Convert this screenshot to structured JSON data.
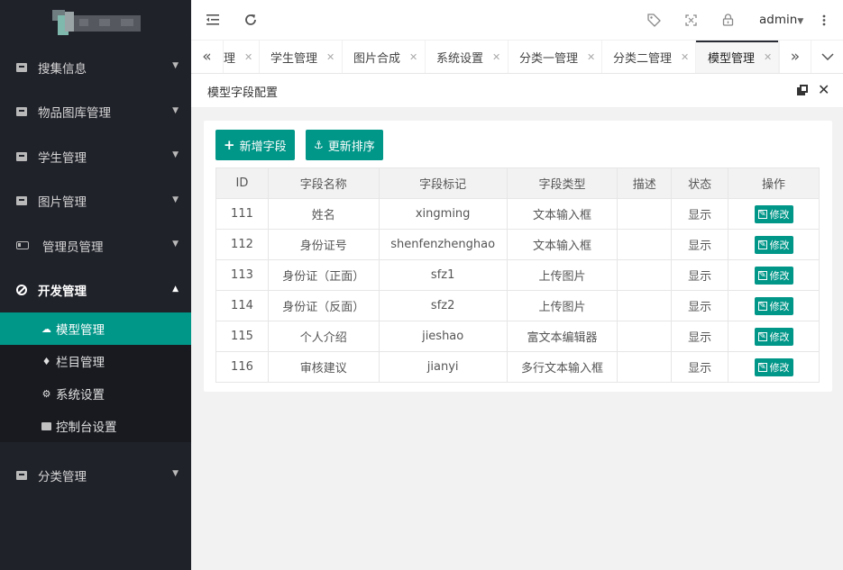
{
  "sidebar": {
    "menu": [
      {
        "label": "搜集信息",
        "icon": "archive-icon"
      },
      {
        "label": "物品图库管理",
        "icon": "archive-icon"
      },
      {
        "label": "学生管理",
        "icon": "archive-icon"
      },
      {
        "label": "图片管理",
        "icon": "archive-icon"
      },
      {
        "label": "管理员管理",
        "icon": "battery-icon"
      },
      {
        "label": "开发管理",
        "icon": "ban-icon"
      },
      {
        "label": "分类管理",
        "icon": "archive-icon"
      }
    ],
    "submenu": [
      {
        "label": "模型管理",
        "icon": "cloud-icon"
      },
      {
        "label": "栏目管理",
        "icon": "bell-icon"
      },
      {
        "label": "系统设置",
        "icon": "gear-icon"
      },
      {
        "label": "控制台设置",
        "icon": "archive-icon"
      }
    ]
  },
  "header": {
    "user": "admin",
    "icons": [
      "collapse-menu-icon",
      "refresh-icon",
      "tag-icon",
      "fullscreen-icon",
      "lock-icon",
      "more-icon"
    ]
  },
  "tabs": {
    "items": [
      {
        "label": "理"
      },
      {
        "label": "学生管理"
      },
      {
        "label": "图片合成"
      },
      {
        "label": "系统设置"
      },
      {
        "label": "分类一管理"
      },
      {
        "label": "分类二管理"
      },
      {
        "label": "模型管理",
        "active": true
      }
    ]
  },
  "page": {
    "title": "模型字段配置",
    "add_button": "新增字段",
    "sort_button": "更新排序",
    "edit_label": "修改",
    "columns": [
      "ID",
      "字段名称",
      "字段标记",
      "字段类型",
      "描述",
      "状态",
      "操作"
    ],
    "rows": [
      {
        "id": "111",
        "name": "姓名",
        "mark": "xingming",
        "type": "文本输入框",
        "desc": "",
        "status": "显示"
      },
      {
        "id": "112",
        "name": "身份证号",
        "mark": "shenfenzhenghao",
        "type": "文本输入框",
        "desc": "",
        "status": "显示"
      },
      {
        "id": "113",
        "name": "身份证（正面）",
        "mark": "sfz1",
        "type": "上传图片",
        "desc": "",
        "status": "显示"
      },
      {
        "id": "114",
        "name": "身份证（反面）",
        "mark": "sfz2",
        "type": "上传图片",
        "desc": "",
        "status": "显示"
      },
      {
        "id": "115",
        "name": "个人介绍",
        "mark": "jieshao",
        "type": "富文本编辑器",
        "desc": "",
        "status": "显示"
      },
      {
        "id": "116",
        "name": "审核建议",
        "mark": "jianyi",
        "type": "多行文本输入框",
        "desc": "",
        "status": "显示"
      }
    ]
  },
  "colors": {
    "sidebar_bg": "#20222a",
    "accent": "#009688"
  }
}
